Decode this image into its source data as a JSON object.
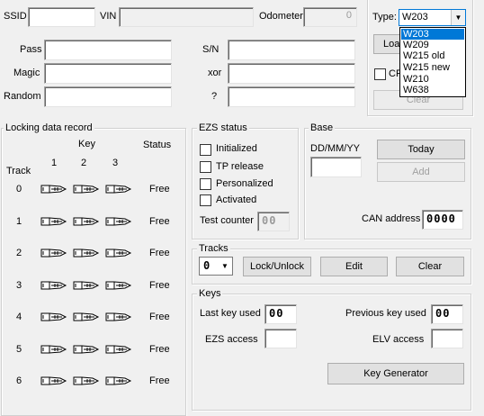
{
  "top": {
    "ssid_label": "SSID",
    "vin_label": "VIN",
    "odometer_label": "Odometer",
    "odometer_value": "0",
    "pass_label": "Pass",
    "magic_label": "Magic",
    "random_label": "Random",
    "sn_label": "S/N",
    "xor_label": "xor",
    "q_label": "?"
  },
  "type": {
    "label": "Type:",
    "selected": "W203",
    "options": [
      "W203",
      "W209",
      "W215 old",
      "W215 new",
      "W210",
      "W638"
    ],
    "load_label": "Loa",
    "cb_label": "CF",
    "clear_label": "Clear"
  },
  "locking": {
    "title": "Locking data record",
    "key_header": "Key",
    "status_header": "Status",
    "track_header": "Track",
    "key_cols": [
      "1",
      "2",
      "3"
    ],
    "rows": [
      {
        "track": "0",
        "status": "Free"
      },
      {
        "track": "1",
        "status": "Free"
      },
      {
        "track": "2",
        "status": "Free"
      },
      {
        "track": "3",
        "status": "Free"
      },
      {
        "track": "4",
        "status": "Free"
      },
      {
        "track": "5",
        "status": "Free"
      },
      {
        "track": "6",
        "status": "Free"
      }
    ]
  },
  "ezs": {
    "title": "EZS status",
    "initialized": "Initialized",
    "tp_release": "TP release",
    "personalized": "Personalized",
    "activated": "Activated",
    "test_counter_label": "Test counter",
    "test_counter_value": "00"
  },
  "base": {
    "title": "Base",
    "date_label": "DD/MM/YY",
    "today_label": "Today",
    "add_label": "Add",
    "can_label": "CAN address",
    "can_value": "0000"
  },
  "tracks": {
    "title": "Tracks",
    "selected": "0",
    "lock_unlock_label": "Lock/Unlock",
    "edit_label": "Edit",
    "clear_label": "Clear"
  },
  "keys": {
    "title": "Keys",
    "last_key_label": "Last key used",
    "last_key_value": "00",
    "prev_key_label": "Previous key used",
    "prev_key_value": "00",
    "ezs_access_label": "EZS access",
    "elv_access_label": "ELV access",
    "key_gen_label": "Key Generator"
  }
}
